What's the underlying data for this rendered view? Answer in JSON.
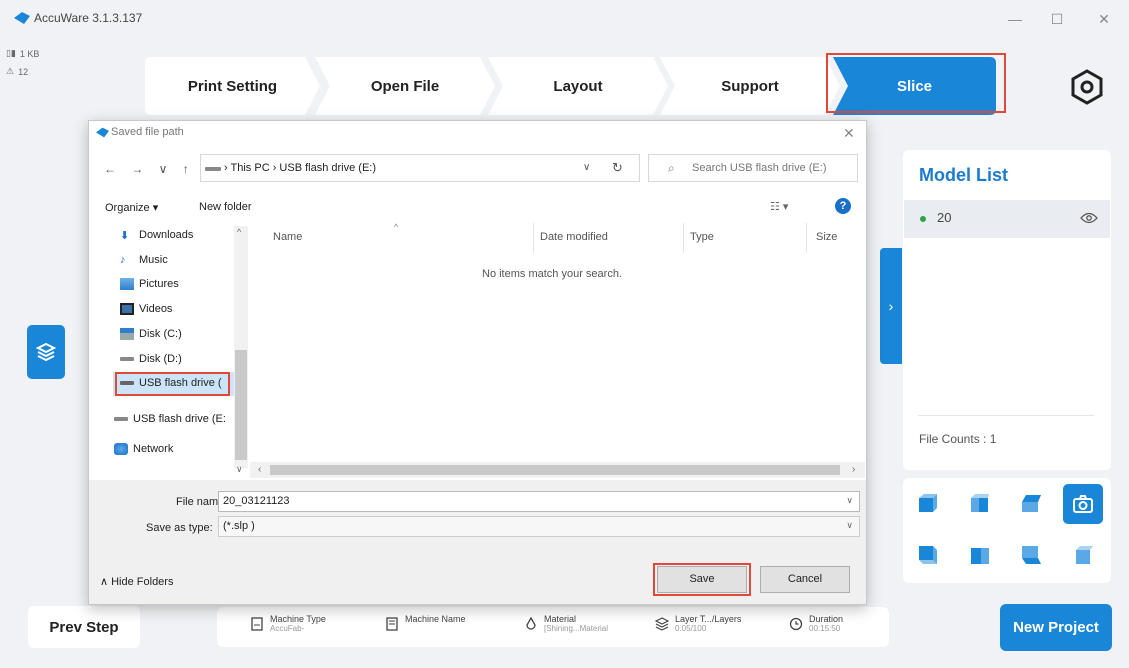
{
  "app": {
    "title": "AccuWare 3.1.3.137",
    "window_controls": {
      "minimize": "—",
      "maximize": "☐",
      "close": "✕"
    }
  },
  "stats": {
    "size": "1 KB",
    "warnings": "12"
  },
  "steps": [
    {
      "label": "Print Setting",
      "active": false
    },
    {
      "label": "Open File",
      "active": false
    },
    {
      "label": "Layout",
      "active": false
    },
    {
      "label": "Support",
      "active": false
    },
    {
      "label": "Slice",
      "active": true
    }
  ],
  "model_list": {
    "title": "Model List",
    "items": [
      {
        "name": "20"
      }
    ],
    "file_counts": "File Counts : 1"
  },
  "bottom": {
    "prev_step": "Prev Step",
    "new_project": "New Project",
    "info": [
      {
        "label": "Machine Type",
        "value": "AccuFab-",
        "icon": "printer-icon"
      },
      {
        "label": "Machine Name",
        "value": "",
        "icon": "tag-icon"
      },
      {
        "label": "Material",
        "value": "[Shining...Material",
        "icon": "drop-icon"
      },
      {
        "label": "Layer T.../Layers",
        "value": "0.05/100",
        "icon": "layers-icon"
      },
      {
        "label": "Duration",
        "value": "00:15:50",
        "icon": "clock-icon"
      }
    ]
  },
  "dialog": {
    "title": "Saved file path",
    "close": "✕",
    "nav": "← → ∨ ↑",
    "address": "›  This PC  ›  USB flash drive (E:)",
    "search_placeholder": "Search USB flash drive (E:)",
    "organize": "Organize ▾",
    "new_folder": "New folder",
    "view_mode": "☷ ▾",
    "help": "?",
    "tree": [
      {
        "label": "Downloads",
        "icon": "download-icon"
      },
      {
        "label": "Music",
        "icon": "music-icon"
      },
      {
        "label": "Pictures",
        "icon": "pictures-icon"
      },
      {
        "label": "Videos",
        "icon": "videos-icon"
      },
      {
        "label": "Disk (C:)",
        "icon": "disk-icon"
      },
      {
        "label": "Disk (D:)",
        "icon": "drive-icon"
      },
      {
        "label": "USB flash drive (",
        "icon": "usb-drive-icon"
      },
      {
        "label": "USB flash drive (E:",
        "icon": "usb-drive-icon"
      },
      {
        "label": "Network",
        "icon": "network-icon"
      }
    ],
    "columns": {
      "name": "Name",
      "date": "Date modified",
      "type": "Type",
      "size": "Size"
    },
    "empty_message": "No items match your search.",
    "file_name_label": "File name:",
    "file_name_value": "20_03121123",
    "save_type_label": "Save as type:",
    "save_type_value": "(*.slp  )",
    "hide_folders": "∧  Hide Folders",
    "save": "Save",
    "cancel": "Cancel"
  },
  "colors": {
    "accent": "#1a86d8",
    "highlight": "#e0483a"
  }
}
